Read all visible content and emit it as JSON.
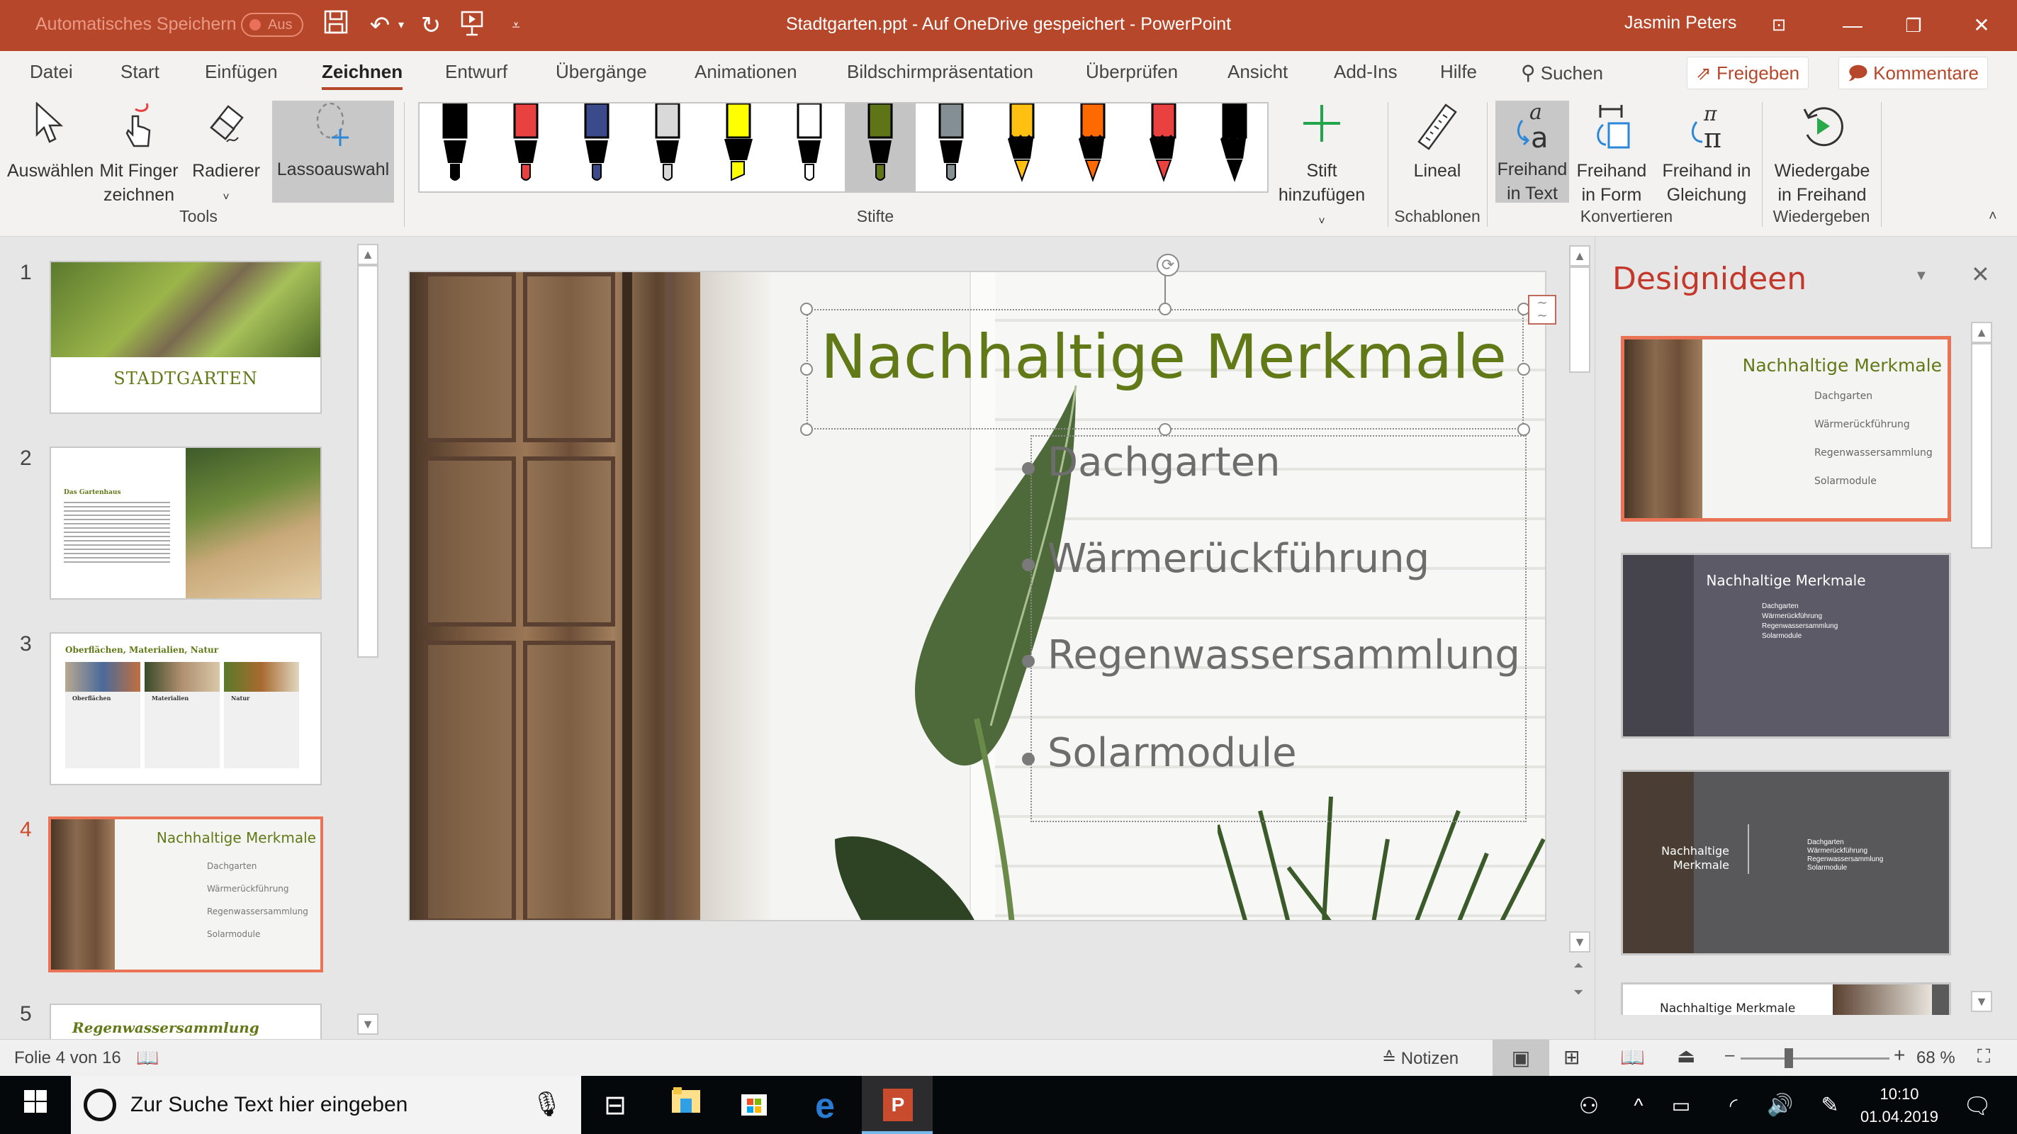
{
  "titlebar": {
    "autosave_label": "Automatisches Speichern",
    "autosave_state": "Aus",
    "document_title": "Stadtgarten.ppt - Auf OneDrive gespeichert - PowerPoint",
    "user_name": "Jasmin Peters",
    "qat_icons": [
      "save-icon",
      "undo-icon",
      "redo-icon",
      "start-slideshow-icon",
      "customize-qat-icon"
    ],
    "window_icons": [
      "ribbon-display-icon",
      "minimize-icon",
      "restore-icon",
      "close-icon"
    ]
  },
  "tabs": [
    {
      "label": "Datei"
    },
    {
      "label": "Start"
    },
    {
      "label": "Einfügen"
    },
    {
      "label": "Zeichnen",
      "active": true
    },
    {
      "label": "Entwurf"
    },
    {
      "label": "Übergänge"
    },
    {
      "label": "Animationen"
    },
    {
      "label": "Bildschirmpräsentation"
    },
    {
      "label": "Überprüfen"
    },
    {
      "label": "Ansicht"
    },
    {
      "label": "Add-Ins"
    },
    {
      "label": "Hilfe"
    }
  ],
  "search_label": "Suchen",
  "share_label": "Freigeben",
  "comments_label": "Kommentare",
  "ribbon": {
    "tools": {
      "label": "Tools",
      "select": "Auswählen",
      "finger_line1": "Mit Finger",
      "finger_line2": "zeichnen",
      "eraser": "Radierer",
      "lasso": "Lassoauswahl"
    },
    "pens": {
      "label": "Stifte",
      "items": [
        {
          "type": "pen",
          "color": "#000000"
        },
        {
          "type": "pen",
          "color": "#e94040"
        },
        {
          "type": "pen",
          "color": "#3a4a8a",
          "note": "galaxy"
        },
        {
          "type": "pen",
          "color": "#d9d9d9"
        },
        {
          "type": "highlighter",
          "color": "#ffff00"
        },
        {
          "type": "pen",
          "color": "#ffffff"
        },
        {
          "type": "pen",
          "color": "#5f7317",
          "selected": true
        },
        {
          "type": "pen",
          "color": "#848f94"
        },
        {
          "type": "pencil",
          "color": "#ffc012"
        },
        {
          "type": "pencil",
          "color": "#ff6a00"
        },
        {
          "type": "pencil",
          "color": "#e94040"
        },
        {
          "type": "pencil",
          "color": "#000000"
        }
      ]
    },
    "add_pen_line1": "Stift",
    "add_pen_line2": "hinzufügen",
    "templates": {
      "label": "Schablonen",
      "ruler": "Lineal"
    },
    "convert": {
      "label": "Konvertieren",
      "ink_text_1": "Freihand",
      "ink_text_2": "in Text",
      "ink_shape_1": "Freihand",
      "ink_shape_2": "in Form",
      "ink_math_1": "Freihand in",
      "ink_math_2": "Gleichung"
    },
    "replay": {
      "label": "Wiedergeben",
      "line1": "Wiedergabe",
      "line2": "in Freihand"
    }
  },
  "thumbnails": [
    {
      "number": "1",
      "title": "STADTGARTEN"
    },
    {
      "number": "2",
      "heading": "Das Gartenhaus"
    },
    {
      "number": "3",
      "heading": "Oberflächen, Materialien, Natur",
      "columns": [
        "Oberflächen",
        "Materialien",
        "Natur"
      ]
    },
    {
      "number": "4",
      "title": "Nachhaltige Merkmale",
      "active": true
    },
    {
      "number": "5",
      "title": "Regenwassersammlung"
    }
  ],
  "slide": {
    "title": "Nachhaltige Merkmale",
    "bullets": [
      "Dachgarten",
      "Wärmerückführung",
      "Regenwassersammlung",
      "Solarmodule"
    ],
    "title_color": "#617a17"
  },
  "design_pane": {
    "title": "Designideen",
    "ideas": [
      {
        "title": "Nachhaltige Merkmale",
        "bullets": [
          "Dachgarten",
          "Wärmerückführung",
          "Regenwassersammlung",
          "Solarmodule"
        ],
        "active": true
      },
      {
        "title": "Nachhaltige Merkmale",
        "bullets": [
          "Dachgarten",
          "Wärmerückführung",
          "Regenwassersammlung",
          "Solarmodule"
        ]
      },
      {
        "title_line1": "Nachhaltige",
        "title_line2": "Merkmale",
        "bullets": [
          "Dachgarten",
          "Wärmerückführung",
          "Regenwassersammlung",
          "Solarmodule"
        ]
      },
      {
        "title": "Nachhaltige Merkmale"
      }
    ]
  },
  "status": {
    "slide_counter": "Folie 4 von 16",
    "notes_label": "Notizen",
    "zoom_percent": "68 %",
    "zoom_value": 68
  },
  "taskbar": {
    "search_placeholder": "Zur Suche Text hier eingeben",
    "time": "10:10",
    "date": "01.04.2019"
  },
  "colors": {
    "accent": "#b7472a",
    "selection": "#ea7356",
    "title_green": "#617a17"
  }
}
